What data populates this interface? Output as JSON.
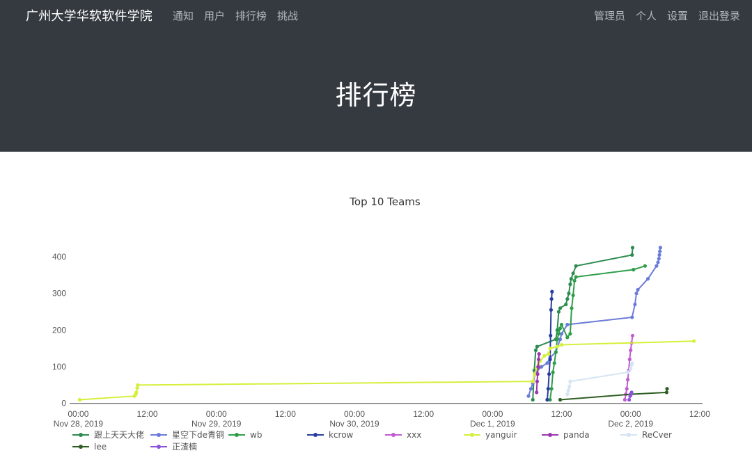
{
  "navbar": {
    "brand": "广州大学华软软件学院",
    "left_links": [
      "通知",
      "用户",
      "排行榜",
      "挑战"
    ],
    "right_links": [
      "管理员",
      "个人",
      "设置",
      "退出登录"
    ]
  },
  "hero": {
    "title": "排行榜"
  },
  "chart_data": {
    "type": "line",
    "title": "Top 10 Teams",
    "xlabel": "",
    "ylabel": "",
    "ylim": [
      -10,
      440
    ],
    "yticks": [
      0,
      100,
      200,
      300,
      400
    ],
    "xlim": [
      "2019-11-27 22:30",
      "2019-12-02 12:30"
    ],
    "xticks": [
      {
        "t": "2019-11-28 00:00",
        "line1": "00:00",
        "line2": "Nov 28, 2019"
      },
      {
        "t": "2019-11-28 12:00",
        "line1": "12:00",
        "line2": ""
      },
      {
        "t": "2019-11-29 00:00",
        "line1": "00:00",
        "line2": "Nov 29, 2019"
      },
      {
        "t": "2019-11-29 12:00",
        "line1": "12:00",
        "line2": ""
      },
      {
        "t": "2019-11-30 00:00",
        "line1": "00:00",
        "line2": "Nov 30, 2019"
      },
      {
        "t": "2019-11-30 12:00",
        "line1": "12:00",
        "line2": ""
      },
      {
        "t": "2019-12-01 00:00",
        "line1": "00:00",
        "line2": "Dec 1, 2019"
      },
      {
        "t": "2019-12-01 12:00",
        "line1": "12:00",
        "line2": ""
      },
      {
        "t": "2019-12-02 00:00",
        "line1": "00:00",
        "line2": "Dec 2, 2019"
      },
      {
        "t": "2019-12-02 12:00",
        "line1": "12:00",
        "line2": ""
      }
    ],
    "legend_position": "bottom",
    "series": [
      {
        "name": "跟上天天大佬",
        "color": "#2c8c4f",
        "points": [
          [
            "2019-12-01 07:00",
            10
          ],
          [
            "2019-12-01 07:15",
            90
          ],
          [
            "2019-12-01 07:30",
            145
          ],
          [
            "2019-12-01 07:45",
            155
          ],
          [
            "2019-12-01 11:00",
            175
          ],
          [
            "2019-12-01 11:15",
            200
          ],
          [
            "2019-12-01 11:30",
            250
          ],
          [
            "2019-12-01 11:45",
            260
          ],
          [
            "2019-12-01 12:45",
            270
          ],
          [
            "2019-12-01 13:00",
            285
          ],
          [
            "2019-12-01 13:15",
            300
          ],
          [
            "2019-12-01 13:30",
            325
          ],
          [
            "2019-12-01 13:40",
            340
          ],
          [
            "2019-12-01 14:00",
            355
          ],
          [
            "2019-12-01 14:30",
            375
          ],
          [
            "2019-12-02 00:15",
            405
          ],
          [
            "2019-12-02 00:20",
            425
          ]
        ]
      },
      {
        "name": "星空下de青铜",
        "color": "#6b7bd9",
        "points": [
          [
            "2019-12-01 06:15",
            20
          ],
          [
            "2019-12-01 06:40",
            40
          ],
          [
            "2019-12-01 07:00",
            55
          ],
          [
            "2019-12-01 07:30",
            85
          ],
          [
            "2019-12-01 08:30",
            100
          ],
          [
            "2019-12-01 09:30",
            110
          ],
          [
            "2019-12-01 10:00",
            125
          ],
          [
            "2019-12-01 11:00",
            140
          ],
          [
            "2019-12-01 11:45",
            175
          ],
          [
            "2019-12-01 12:00",
            190
          ],
          [
            "2019-12-01 13:00",
            215
          ],
          [
            "2019-12-02 00:15",
            235
          ],
          [
            "2019-12-02 00:45",
            270
          ],
          [
            "2019-12-02 01:00",
            300
          ],
          [
            "2019-12-02 01:15",
            310
          ],
          [
            "2019-12-02 03:00",
            340
          ],
          [
            "2019-12-02 04:30",
            375
          ],
          [
            "2019-12-02 04:45",
            385
          ],
          [
            "2019-12-02 04:55",
            395
          ],
          [
            "2019-12-02 05:00",
            405
          ],
          [
            "2019-12-02 05:05",
            415
          ],
          [
            "2019-12-02 05:10",
            425
          ]
        ]
      },
      {
        "name": "wb",
        "color": "#2e9e4a",
        "points": [
          [
            "2019-12-01 10:00",
            10
          ],
          [
            "2019-12-01 10:15",
            40
          ],
          [
            "2019-12-01 10:30",
            85
          ],
          [
            "2019-12-01 10:45",
            110
          ],
          [
            "2019-12-01 11:00",
            140
          ],
          [
            "2019-12-01 11:15",
            175
          ],
          [
            "2019-12-01 11:30",
            190
          ],
          [
            "2019-12-01 11:45",
            205
          ],
          [
            "2019-12-01 12:00",
            215
          ],
          [
            "2019-12-01 13:00",
            180
          ],
          [
            "2019-12-01 13:30",
            190
          ],
          [
            "2019-12-01 13:45",
            260
          ],
          [
            "2019-12-01 14:00",
            295
          ],
          [
            "2019-12-01 14:15",
            335
          ],
          [
            "2019-12-01 14:30",
            345
          ],
          [
            "2019-12-02 00:30",
            365
          ],
          [
            "2019-12-02 02:30",
            375
          ]
        ]
      },
      {
        "name": "kcrow",
        "color": "#283e9e",
        "points": [
          [
            "2019-12-01 09:30",
            10
          ],
          [
            "2019-12-01 09:40",
            40
          ],
          [
            "2019-12-01 09:50",
            80
          ],
          [
            "2019-12-01 10:00",
            120
          ],
          [
            "2019-12-01 10:05",
            185
          ],
          [
            "2019-12-01 10:10",
            255
          ],
          [
            "2019-12-01 10:15",
            285
          ],
          [
            "2019-12-01 10:20",
            305
          ]
        ]
      },
      {
        "name": "xxx",
        "color": "#c05cd1",
        "points": [
          [
            "2019-12-01 23:00",
            10
          ],
          [
            "2019-12-01 23:10",
            25
          ],
          [
            "2019-12-01 23:20",
            40
          ],
          [
            "2019-12-01 23:30",
            65
          ],
          [
            "2019-12-01 23:40",
            90
          ],
          [
            "2019-12-01 23:50",
            120
          ],
          [
            "2019-12-02 00:00",
            145
          ],
          [
            "2019-12-02 00:10",
            165
          ],
          [
            "2019-12-02 00:20",
            185
          ]
        ]
      },
      {
        "name": "yanguir",
        "color": "#d6ef3c",
        "points": [
          [
            "2019-11-28 00:15",
            10
          ],
          [
            "2019-11-28 09:45",
            20
          ],
          [
            "2019-11-28 10:00",
            25
          ],
          [
            "2019-11-28 10:05",
            30
          ],
          [
            "2019-11-28 10:15",
            42
          ],
          [
            "2019-11-28 10:20",
            50
          ],
          [
            "2019-12-01 07:00",
            60
          ],
          [
            "2019-12-01 07:20",
            80
          ],
          [
            "2019-12-01 07:40",
            95
          ],
          [
            "2019-12-01 08:00",
            105
          ],
          [
            "2019-12-01 08:15",
            115
          ],
          [
            "2019-12-01 09:00",
            130
          ],
          [
            "2019-12-01 09:45",
            135
          ],
          [
            "2019-12-01 10:00",
            150
          ],
          [
            "2019-12-01 11:15",
            155
          ],
          [
            "2019-12-01 12:00",
            160
          ],
          [
            "2019-12-02 11:00",
            170
          ]
        ]
      },
      {
        "name": "panda",
        "color": "#9c37ae",
        "points": [
          [
            "2019-12-01 07:40",
            30
          ],
          [
            "2019-12-01 07:45",
            60
          ],
          [
            "2019-12-01 07:50",
            80
          ],
          [
            "2019-12-01 07:55",
            100
          ],
          [
            "2019-12-01 08:00",
            120
          ],
          [
            "2019-12-01 08:05",
            135
          ]
        ]
      },
      {
        "name": "ReCver",
        "color": "#d5e4f3",
        "points": [
          [
            "2019-12-01 13:00",
            25
          ],
          [
            "2019-12-01 13:10",
            35
          ],
          [
            "2019-12-01 13:20",
            45
          ],
          [
            "2019-12-01 13:30",
            60
          ],
          [
            "2019-12-01 23:30",
            85
          ],
          [
            "2019-12-02 00:00",
            95
          ],
          [
            "2019-12-02 00:10",
            105
          ],
          [
            "2019-12-02 00:15",
            110
          ]
        ]
      },
      {
        "name": "lee",
        "color": "#2f5e22",
        "points": [
          [
            "2019-12-01 11:45",
            10
          ],
          [
            "2019-12-02 00:00",
            25
          ],
          [
            "2019-12-02 06:15",
            30
          ],
          [
            "2019-12-02 06:20",
            40
          ]
        ]
      },
      {
        "name": "正渣楠",
        "color": "#8a55d8",
        "points": [
          [
            "2019-12-01 23:45",
            10
          ],
          [
            "2019-12-01 23:55",
            20
          ],
          [
            "2019-12-02 00:05",
            25
          ],
          [
            "2019-12-02 00:10",
            30
          ]
        ]
      }
    ]
  }
}
